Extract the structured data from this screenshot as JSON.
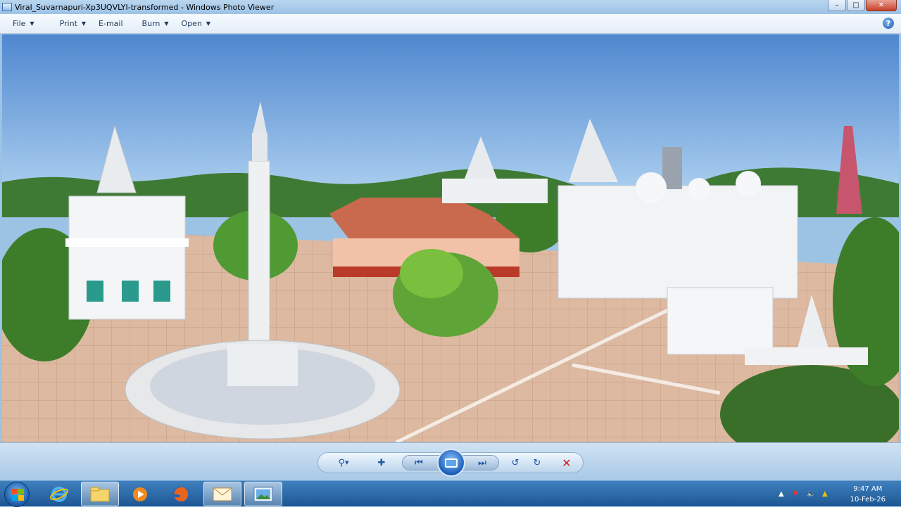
{
  "window": {
    "title": "Viral_Suvarnapuri-Xp3UQVLYI-transformed - Windows Photo Viewer",
    "minimize_icon": "minimize-icon",
    "maximize_icon": "maximize-icon",
    "close_icon": "close-icon"
  },
  "menu": {
    "items": [
      {
        "label": "File",
        "has_dropdown": true
      },
      {
        "label": "Print",
        "has_dropdown": true
      },
      {
        "label": "E-mail",
        "has_dropdown": false
      },
      {
        "label": "Burn",
        "has_dropdown": true
      },
      {
        "label": "Open",
        "has_dropdown": true
      }
    ],
    "help_icon": "?"
  },
  "controls": {
    "zoom_icon": "magnifier-icon",
    "actual_size_icon": "fit-window-icon",
    "previous_icon": "previous-icon",
    "slideshow_icon": "slideshow-icon",
    "next_icon": "next-icon",
    "rotate_ccw_icon": "rotate-counterclockwise-icon",
    "rotate_cw_icon": "rotate-clockwise-icon",
    "delete_icon": "delete-icon"
  },
  "taskbar": {
    "items": [
      "internet-explorer-icon",
      "file-explorer-icon",
      "media-player-icon",
      "firefox-icon",
      "mail-app-icon",
      "photo-viewer-icon"
    ],
    "clock_time": "9:47 AM",
    "clock_date": "10-Feb-26"
  },
  "colors": {
    "titlebar": "#a9cbea",
    "taskbar": "#2a6aa8",
    "sky": "#5c92d3",
    "plaza": "#d9b8a1"
  }
}
